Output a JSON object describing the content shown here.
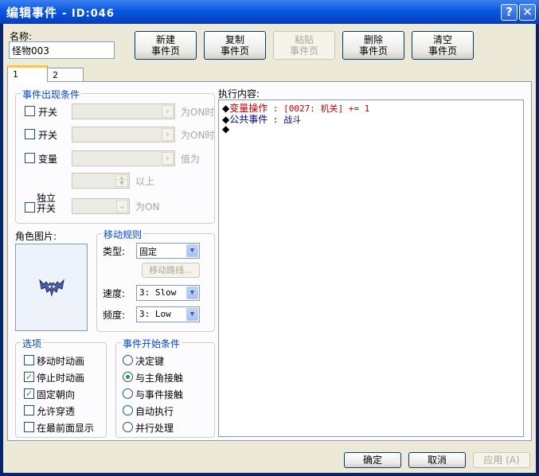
{
  "window": {
    "title": "编辑事件",
    "id_label": "- ID:046",
    "help_glyph": "?",
    "close_glyph": "✕"
  },
  "name": {
    "label": "名称:",
    "value": "怪物003"
  },
  "page_buttons": [
    {
      "line1": "新建",
      "line2": "事件页"
    },
    {
      "line1": "复制",
      "line2": "事件页"
    },
    {
      "line1": "粘贴",
      "line2": "事件页"
    },
    {
      "line1": "删除",
      "line2": "事件页"
    },
    {
      "line1": "清空",
      "line2": "事件页"
    }
  ],
  "tabs": [
    "1",
    "2"
  ],
  "conditions": {
    "title": "事件出现条件",
    "switch1": {
      "label": "开关",
      "suffix": "为ON时"
    },
    "switch2": {
      "label": "开关",
      "suffix": "为ON时"
    },
    "variable": {
      "label": "变量",
      "suffix": "值为",
      "compare": "以上"
    },
    "self_switch": {
      "label_line1": "独立",
      "label_line2": "开关",
      "suffix": "为ON"
    }
  },
  "graphic": {
    "label": "角色图片:",
    "icon": "bat-monster-sprite"
  },
  "movement": {
    "title": "移动规则",
    "type_label": "类型:",
    "type_value": "固定",
    "route_button": "移动路线...",
    "speed_label": "速度:",
    "speed_value": "3: Slow",
    "freq_label": "频度:",
    "freq_value": "3: Low"
  },
  "options": {
    "title": "选项",
    "items": [
      {
        "label": "移动时动画",
        "checked": false
      },
      {
        "label": "停止时动画",
        "checked": true
      },
      {
        "label": "固定朝向",
        "checked": true
      },
      {
        "label": "允许穿透",
        "checked": false
      },
      {
        "label": "在最前面显示",
        "checked": false
      }
    ]
  },
  "trigger": {
    "title": "事件开始条件",
    "items": [
      {
        "label": "决定键",
        "selected": false
      },
      {
        "label": "与主角接触",
        "selected": true
      },
      {
        "label": "与事件接触",
        "selected": false
      },
      {
        "label": "自动执行",
        "selected": false
      },
      {
        "label": "并行处理",
        "selected": false
      }
    ]
  },
  "commands": {
    "label": "执行内容:",
    "lines": [
      {
        "bullet": "◆",
        "name": "变量操作",
        "sep": " : ",
        "detail": "[0027: 机关] += 1",
        "color": "#c00000"
      },
      {
        "bullet": "◆",
        "name": "公共事件",
        "sep": " : ",
        "detail": "战斗",
        "color": "#00008b"
      },
      {
        "bullet": "◆",
        "name": "",
        "sep": "",
        "detail": "",
        "color": "#000000"
      }
    ]
  },
  "footer": {
    "ok": "确定",
    "cancel": "取消",
    "apply": "应用 (A)"
  },
  "colors": {
    "accent": "#0a58e0",
    "group_title": "#0046d5",
    "check": "#21a121"
  }
}
